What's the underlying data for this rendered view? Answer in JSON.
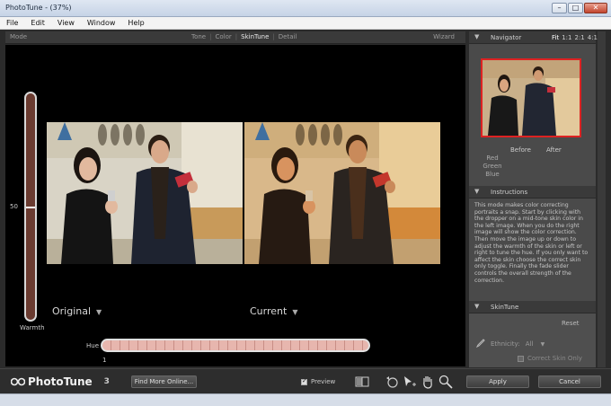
{
  "window": {
    "title": "PhotoTune - (37%)"
  },
  "menu": {
    "items": [
      "File",
      "Edit",
      "View",
      "Window",
      "Help"
    ]
  },
  "modebar": {
    "label": "Mode",
    "tabs": [
      "Tone",
      "Color",
      "SkinTune",
      "Detail"
    ],
    "active_tab": "SkinTune",
    "wizard_label": "Wizard"
  },
  "canvas": {
    "warmth_value": "50",
    "warmth_label": "Warmth",
    "warmth_level_fraction": 0.5,
    "original_label": "Original",
    "current_label": "Current",
    "hue_label": "Hue",
    "hue_value": "1"
  },
  "navigator": {
    "title": "Navigator",
    "zoom_options": [
      "Fit",
      "1:1",
      "2:1",
      "4:1"
    ],
    "before_label": "Before",
    "after_label": "After",
    "rgb": [
      "Red",
      "Green",
      "Blue"
    ]
  },
  "instructions": {
    "title": "Instructions",
    "text": "This mode makes color correcting portraits a snap. Start by clicking with the dropper on a mid-tone skin color in the left image. When you do the right image will show the color correction. Then move the image up or down to adjust the warmth of the skin or left or right to tune the hue. If you only want to affect the skin choose the correct skin only toggle. Finally the fade slider controls the overall strength of the correction."
  },
  "skintune": {
    "title": "SkinTune",
    "reset_label": "Reset",
    "ethnicity_label": "Ethnicity:",
    "ethnicity_value": "All",
    "correct_skin_only_label": "Correct Skin Only"
  },
  "bottom": {
    "logo_text": "PhotoTune",
    "version": "3",
    "find_more_label": "Find More Online...",
    "preview_label": "Preview",
    "apply_label": "Apply",
    "cancel_label": "Cancel"
  },
  "colors": {
    "active_tab": "#e9e9e9",
    "accent_red": "#dd2222",
    "warmth_track": "#6a3b30",
    "hue_track": "#e7b6ae"
  }
}
